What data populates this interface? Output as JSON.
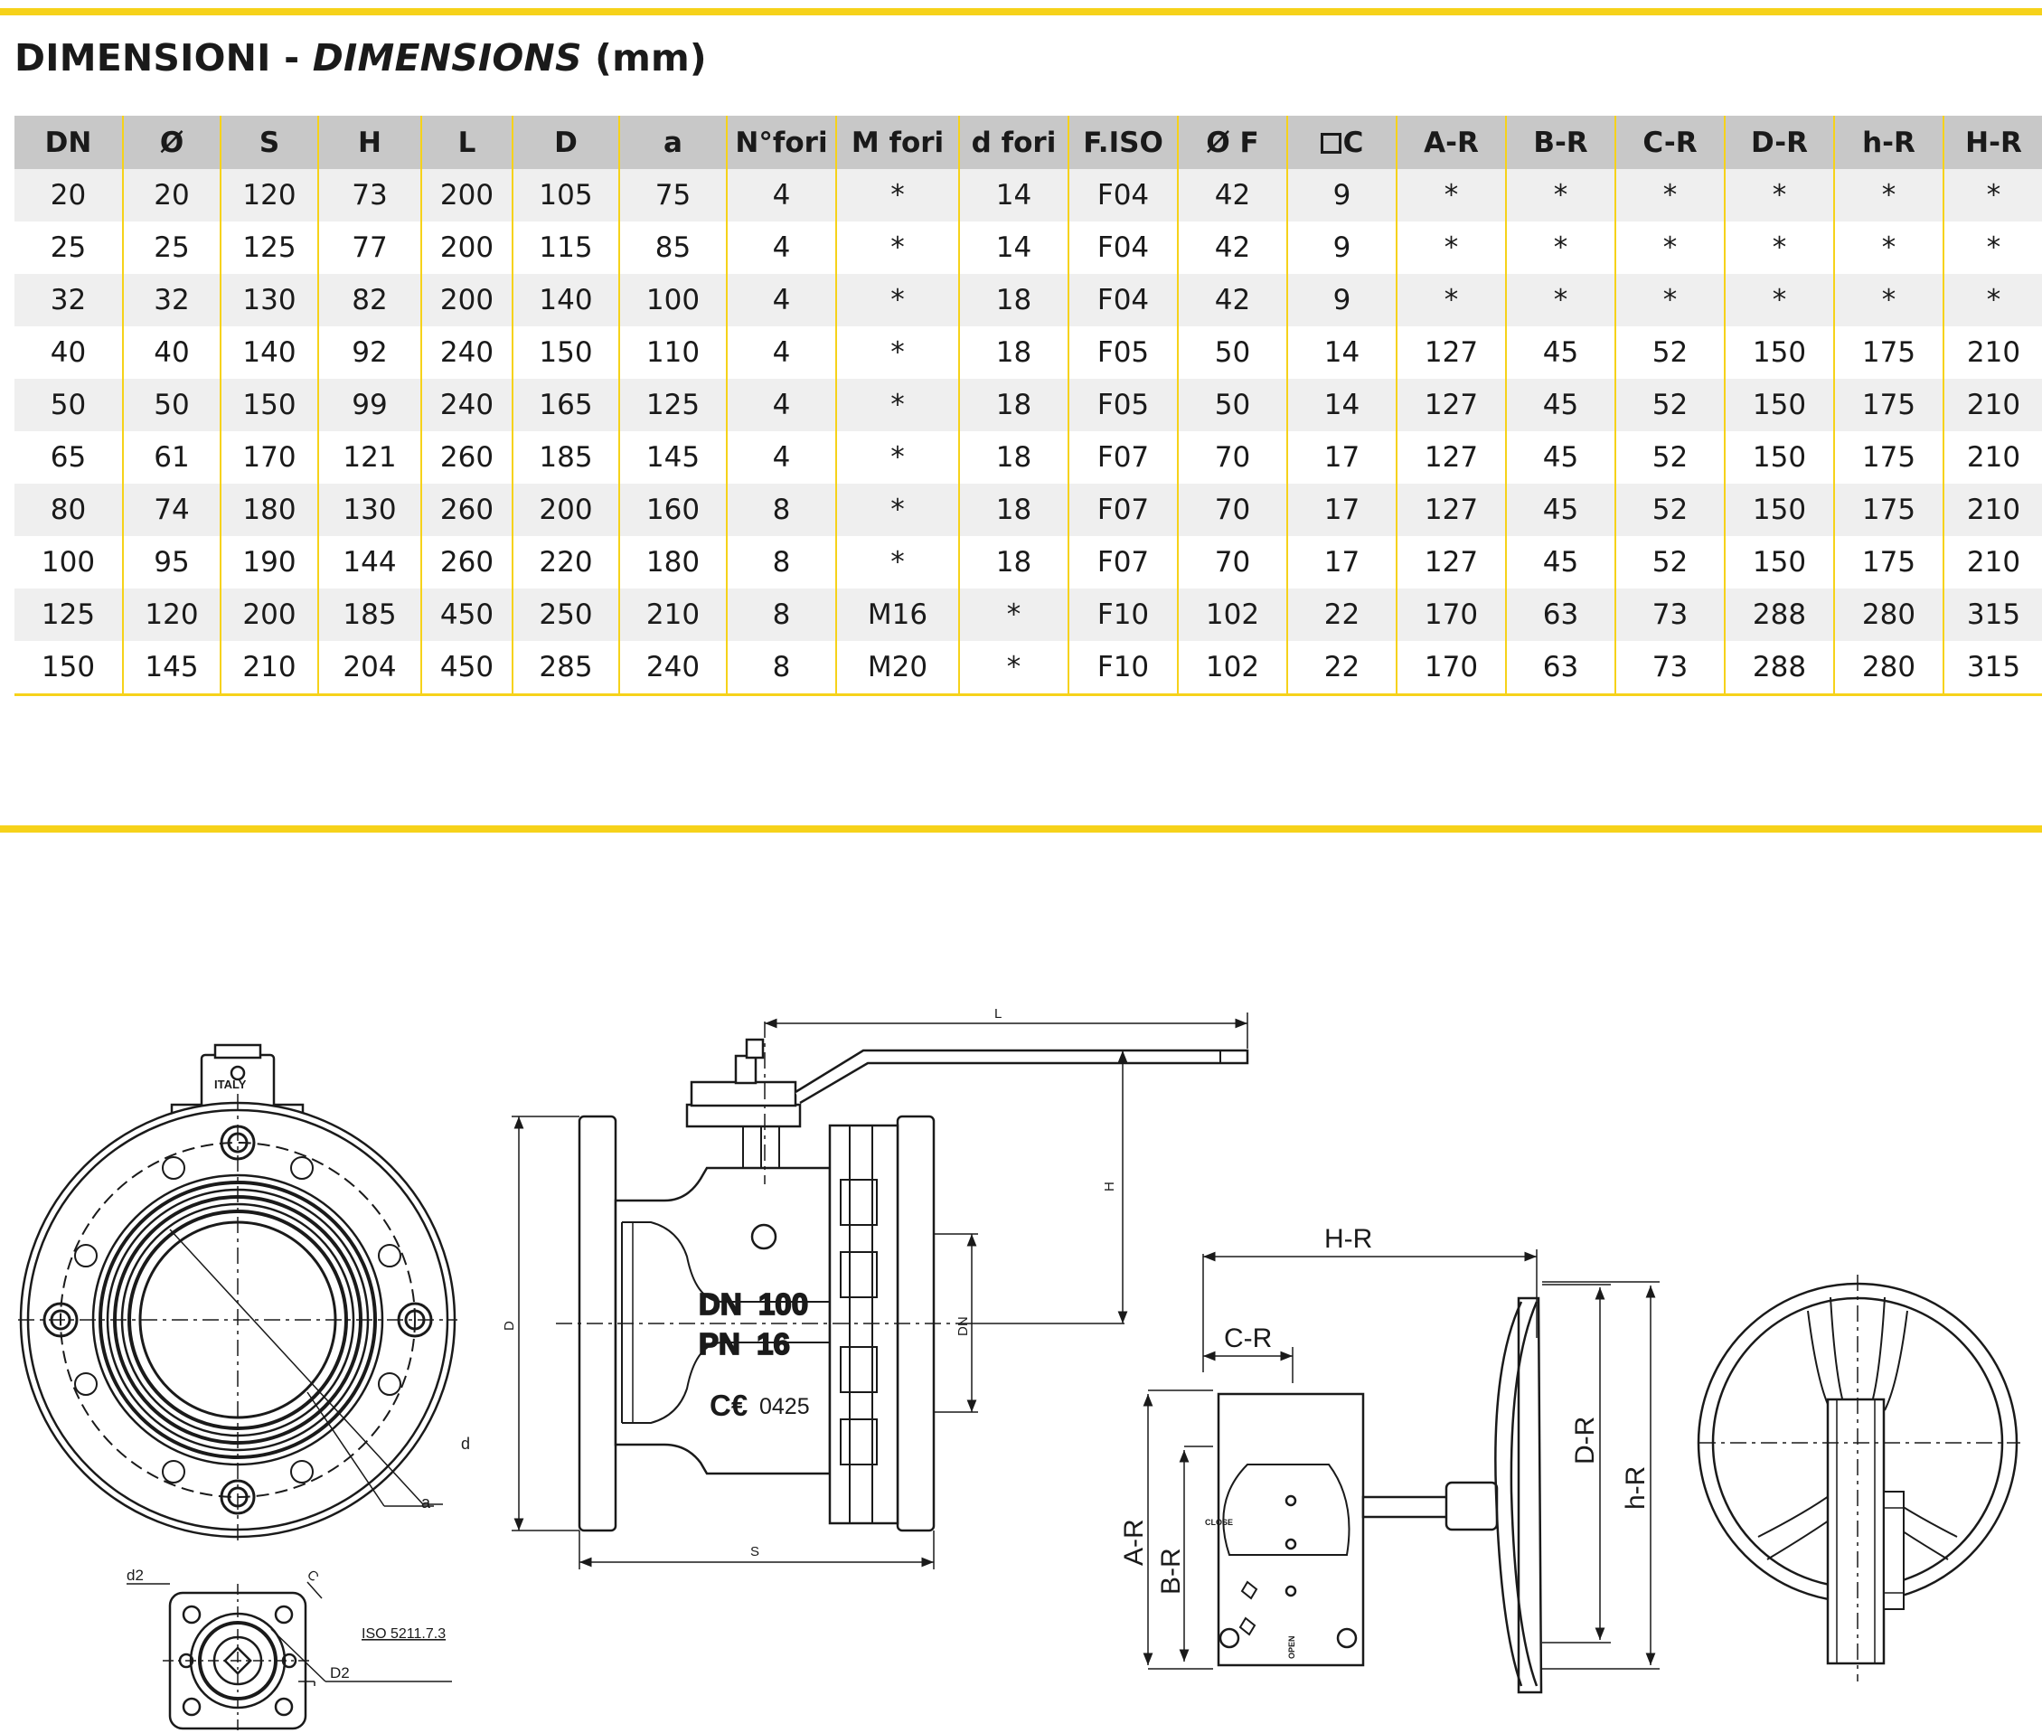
{
  "title": {
    "main": "DIMENSIONI - ",
    "italic": "DIMENSIONS",
    "unit": " (mm)"
  },
  "table": {
    "headers": [
      "DN",
      "Ø",
      "S",
      "H",
      "L",
      "D",
      "a",
      "N°fori",
      "M fori",
      "d fori",
      "F.ISO",
      "Ø F",
      "C",
      "A-R",
      "B-R",
      "C-R",
      "D-R",
      "h-R",
      "H-R"
    ],
    "rows": [
      [
        "20",
        "20",
        "120",
        "73",
        "200",
        "105",
        "75",
        "4",
        "*",
        "14",
        "F04",
        "42",
        "9",
        "*",
        "*",
        "*",
        "*",
        "*",
        "*"
      ],
      [
        "25",
        "25",
        "125",
        "77",
        "200",
        "115",
        "85",
        "4",
        "*",
        "14",
        "F04",
        "42",
        "9",
        "*",
        "*",
        "*",
        "*",
        "*",
        "*"
      ],
      [
        "32",
        "32",
        "130",
        "82",
        "200",
        "140",
        "100",
        "4",
        "*",
        "18",
        "F04",
        "42",
        "9",
        "*",
        "*",
        "*",
        "*",
        "*",
        "*"
      ],
      [
        "40",
        "40",
        "140",
        "92",
        "240",
        "150",
        "110",
        "4",
        "*",
        "18",
        "F05",
        "50",
        "14",
        "127",
        "45",
        "52",
        "150",
        "175",
        "210"
      ],
      [
        "50",
        "50",
        "150",
        "99",
        "240",
        "165",
        "125",
        "4",
        "*",
        "18",
        "F05",
        "50",
        "14",
        "127",
        "45",
        "52",
        "150",
        "175",
        "210"
      ],
      [
        "65",
        "61",
        "170",
        "121",
        "260",
        "185",
        "145",
        "4",
        "*",
        "18",
        "F07",
        "70",
        "17",
        "127",
        "45",
        "52",
        "150",
        "175",
        "210"
      ],
      [
        "80",
        "74",
        "180",
        "130",
        "260",
        "200",
        "160",
        "8",
        "*",
        "18",
        "F07",
        "70",
        "17",
        "127",
        "45",
        "52",
        "150",
        "175",
        "210"
      ],
      [
        "100",
        "95",
        "190",
        "144",
        "260",
        "220",
        "180",
        "8",
        "*",
        "18",
        "F07",
        "70",
        "17",
        "127",
        "45",
        "52",
        "150",
        "175",
        "210"
      ],
      [
        "125",
        "120",
        "200",
        "185",
        "450",
        "250",
        "210",
        "8",
        "M16",
        "*",
        "F10",
        "102",
        "22",
        "170",
        "63",
        "73",
        "288",
        "280",
        "315"
      ],
      [
        "150",
        "145",
        "210",
        "204",
        "450",
        "285",
        "240",
        "8",
        "M20",
        "*",
        "F10",
        "102",
        "22",
        "170",
        "63",
        "73",
        "288",
        "280",
        "315"
      ]
    ]
  },
  "drawing": {
    "front": {
      "italy": "ITALY",
      "d": "d",
      "a": "a"
    },
    "flange": {
      "d2": "d2",
      "c": "C",
      "iso": "ISO 5211.7.3",
      "D2": "D2"
    },
    "side": {
      "L": "L",
      "H": "H",
      "D": "D",
      "DN": "DN",
      "S": "S",
      "mark_dn": "DN  100",
      "mark_pn": "PN  16",
      "ce": "C€",
      "ce_num": "0425"
    },
    "gear": {
      "HR": "H-R",
      "CR": "C-R",
      "AR": "A-R",
      "BR": "B-R",
      "DR": "D-R",
      "hR": "h-R",
      "close": "CLOSE",
      "open": "OPEN"
    }
  }
}
